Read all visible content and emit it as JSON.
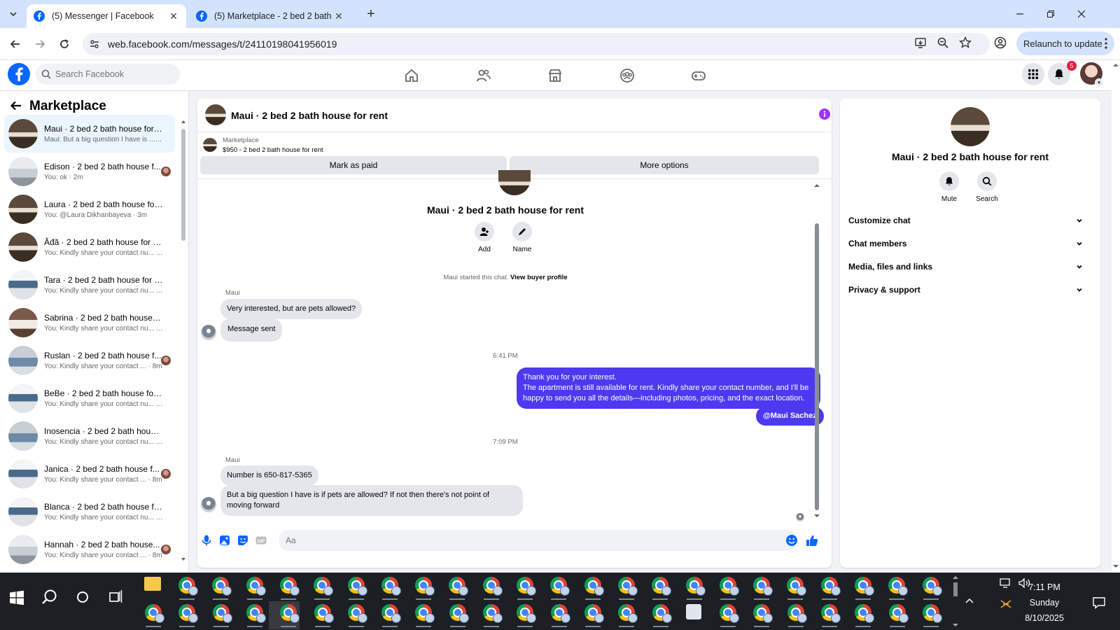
{
  "browser": {
    "tabs": [
      {
        "title": "(5) Messenger | Facebook",
        "active": true
      },
      {
        "title": "(5) Marketplace - 2 bed 2 bath h",
        "active": false
      }
    ],
    "url": "web.facebook.com/messages/t/24110198041956019",
    "relaunch_label": "Relaunch to update"
  },
  "fb": {
    "search_placeholder": "Search Facebook",
    "notification_count": "5",
    "brand_color": "#0866ff"
  },
  "left": {
    "header": "Marketplace",
    "chats": [
      {
        "name": "Maui · 2 bed 2 bath house for r...",
        "snippet": "Maui: But a big question I have is ... · 1m",
        "active": true,
        "read": false
      },
      {
        "name": "Edison · 2 bed 2 bath house f...",
        "snippet": "You: ok · 2m",
        "active": false,
        "read": true
      },
      {
        "name": "Laura · 2 bed 2 bath house for r...",
        "snippet": "You: @Laura Dikhanbayeva · 3m",
        "active": false,
        "read": false
      },
      {
        "name": "Ăđă · 2 bed 2 bath house for rent",
        "snippet": "You: Kindly share your contact nu... · 7m",
        "active": false,
        "read": false
      },
      {
        "name": "Tara · 2 bed 2 bath house for rent",
        "snippet": "You: Kindly share your contact nu... · 7m",
        "active": false,
        "read": false
      },
      {
        "name": "Sabrina · 2 bed 2 bath house fo...",
        "snippet": "You: Kindly share your contact nu... · 8m",
        "active": false,
        "read": false
      },
      {
        "name": "Ruslan · 2 bed 2 bath house f...",
        "snippet": "You: Kindly share your contact ... · 8m",
        "active": false,
        "read": true
      },
      {
        "name": "BeBe · 2 bed 2 bath house for r...",
        "snippet": "You: Kindly share your contact nu... · 8m",
        "active": false,
        "read": false
      },
      {
        "name": "Inosencia · 2 bed 2 bath house ...",
        "snippet": "You: Kindly share your contact nu... · 8m",
        "active": false,
        "read": false
      },
      {
        "name": "Janica · 2 bed 2 bath house f...",
        "snippet": "You: Kindly share your contact ... · 8m",
        "active": false,
        "read": true
      },
      {
        "name": "Blanca · 2 bed 2 bath house for ...",
        "snippet": "You: Kindly share your contact nu... · 8m",
        "active": false,
        "read": false
      },
      {
        "name": "Hannah · 2 bed 2 bath house...",
        "snippet": "You: Kindly share your contact ... · 8m",
        "active": false,
        "read": true
      }
    ]
  },
  "conversation": {
    "title": "Maui · 2 bed 2 bath house for rent",
    "marketplace_label": "Marketplace",
    "listing": "$950 - 2 bed 2 bath house for rent",
    "mark_paid": "Mark as paid",
    "more_options": "More options",
    "profile_name": "Maui · 2 bed 2 bath house for rent",
    "add_label": "Add",
    "name_label": "Name",
    "started_text": "Maui started this chat.",
    "view_buyer": "View buyer profile",
    "sender": "Maui",
    "msg1": "Very interested, but are pets allowed?",
    "msg2": "Message sent",
    "time1": "6:41 PM",
    "out1_line1": "Thank you for your interest.",
    "out1_line2": "The apartment is still available for rent. Kindly share your contact number, and I'll be",
    "out1_line3": "happy to send you all the details—including photos, pricing, and the exact location.",
    "out2": "@Maui Sachez",
    "time2": "7:09 PM",
    "msg3": "Number is 650-817-5365",
    "msg4_line1": "But a big question I have is if pets are allowed? If not then there's not point of",
    "msg4_line2": "moving forward",
    "composer_placeholder": "Aa",
    "accent": "#4c39f0"
  },
  "right": {
    "name": "Maui · 2 bed 2 bath house for rent",
    "mute": "Mute",
    "search": "Search",
    "sections": [
      "Customize chat",
      "Chat members",
      "Media, files and links",
      "Privacy & support"
    ]
  },
  "taskbar": {
    "time": "7:11 PM",
    "day": "Sunday",
    "date": "8/10/2025"
  }
}
